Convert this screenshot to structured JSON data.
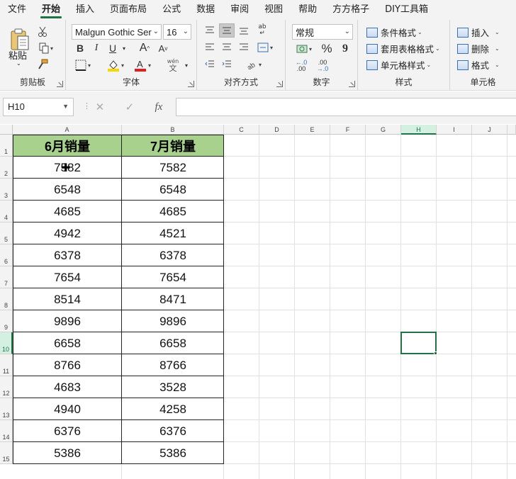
{
  "menu": {
    "tabs": [
      "文件",
      "开始",
      "插入",
      "页面布局",
      "公式",
      "数据",
      "审阅",
      "视图",
      "帮助",
      "方方格子",
      "DIY工具箱"
    ],
    "active_index": 1
  },
  "ribbon": {
    "clipboard": {
      "label": "剪贴板",
      "paste_label": "粘贴"
    },
    "font": {
      "label": "字体",
      "font_name": "Malgun Gothic Ser",
      "font_size": "16",
      "bold": "B",
      "italic": "I",
      "underline": "U",
      "grow": "A",
      "shrink": "A",
      "phonetic_top": "wén",
      "phonetic_bottom": "文",
      "highlight_color": "#ffd400",
      "font_color": "#e02020"
    },
    "alignment": {
      "label": "对齐方式",
      "wrap_glyph": "ab"
    },
    "number": {
      "label": "数字",
      "format": "常规",
      "percent": "%",
      "comma": "9",
      "inc_dec": ".0",
      "inc_dec2": ".00",
      "dec_dec": ".00",
      "dec_dec2": ".0"
    },
    "styles": {
      "label": "样式",
      "conditional": "条件格式",
      "table_format": "套用表格格式",
      "cell_styles": "单元格样式"
    },
    "cells": {
      "label": "单元格",
      "insert": "插入",
      "delete": "删除",
      "format": "格式"
    }
  },
  "formula_bar": {
    "name_box": "H10",
    "cancel": "✕",
    "enter": "✓",
    "fx": "fx",
    "value": ""
  },
  "sheet": {
    "columns": [
      "A",
      "B",
      "C",
      "D",
      "E",
      "F",
      "G",
      "H",
      "I",
      "J"
    ],
    "rows": [
      "1",
      "2",
      "3",
      "4",
      "5",
      "6",
      "7",
      "8",
      "9",
      "10",
      "11",
      "12",
      "13",
      "14",
      "15"
    ],
    "active_col": "H",
    "active_row": "10",
    "headers": [
      "6月销量",
      "7月销量"
    ],
    "data": [
      [
        "7582",
        "7582"
      ],
      [
        "6548",
        "6548"
      ],
      [
        "4685",
        "4685"
      ],
      [
        "4942",
        "4521"
      ],
      [
        "6378",
        "6378"
      ],
      [
        "7654",
        "7654"
      ],
      [
        "8514",
        "8471"
      ],
      [
        "9896",
        "9896"
      ],
      [
        "6658",
        "6658"
      ],
      [
        "8766",
        "8766"
      ],
      [
        "4683",
        "3528"
      ],
      [
        "4940",
        "4258"
      ],
      [
        "6376",
        "6376"
      ],
      [
        "5386",
        "5386"
      ]
    ],
    "header_fill": "#a9d18e",
    "accent": "#217346"
  }
}
